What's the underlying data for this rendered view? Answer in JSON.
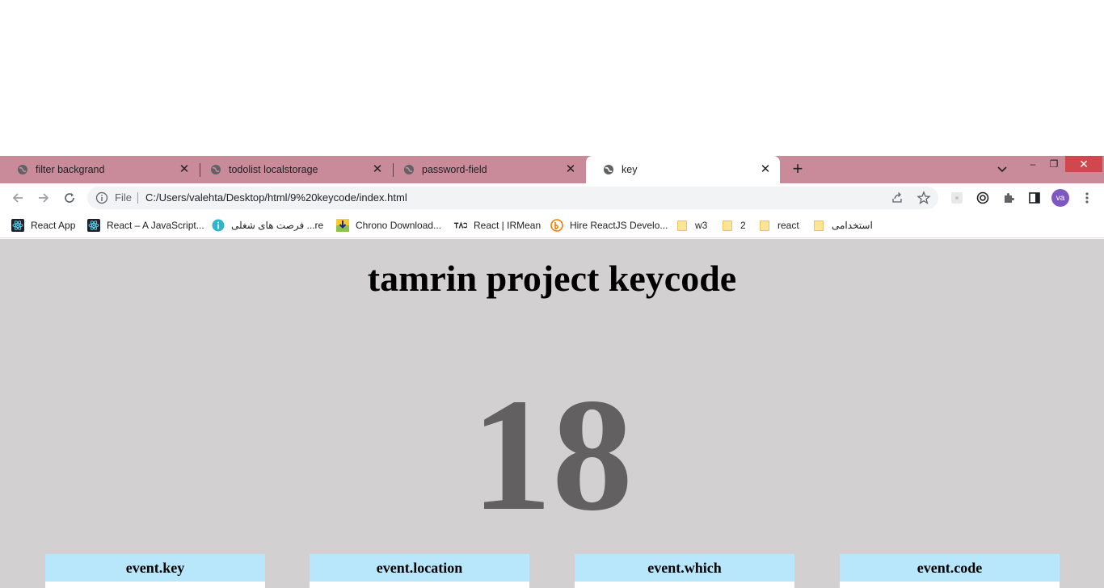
{
  "browser": {
    "tabs": [
      {
        "title": "filter backgrand",
        "active": false
      },
      {
        "title": "todolist localstorage",
        "active": false
      },
      {
        "title": "password-field",
        "active": false
      },
      {
        "title": "key",
        "active": true
      }
    ],
    "tab_close_glyph": "✕",
    "new_tab_glyph": "+",
    "window_controls": {
      "minimize": "–",
      "restore": "❐",
      "close": "✕"
    },
    "colors": {
      "tab_strip": "#c98a99",
      "active_tab": "#ffffff",
      "close_button": "#d0474d"
    }
  },
  "toolbar": {
    "scheme_label": "File",
    "url": "C:/Users/valehta/Desktop/html/9%20keycode/index.html",
    "avatar_initials": "va",
    "avatar_color": "#7e57c2"
  },
  "bookmarks": [
    {
      "label": "React App",
      "icon": "react-icon"
    },
    {
      "label": "React – A JavaScript...",
      "icon": "react-icon"
    },
    {
      "label": "فرصت های شغلی ...re",
      "icon": "jobinja-icon"
    },
    {
      "label": "Chrono Download...",
      "icon": "download-icon"
    },
    {
      "label": "React | IRMean",
      "icon": "irmean-icon"
    },
    {
      "label": "Hire ReactJS Develo...",
      "icon": "hire-icon"
    },
    {
      "label": "w3",
      "icon": "folder-icon"
    },
    {
      "label": "2",
      "icon": "folder-icon"
    },
    {
      "label": "react",
      "icon": "folder-icon"
    },
    {
      "label": "استخدامی",
      "icon": "folder-icon"
    }
  ],
  "page": {
    "title": "tamrin project keycode",
    "keycode": "18",
    "cards": [
      {
        "label": "event.key"
      },
      {
        "label": "event.location"
      },
      {
        "label": "event.which"
      },
      {
        "label": "event.code"
      }
    ],
    "colors": {
      "background": "#d2d0d1",
      "keycode_text": "#626061",
      "card_header": "#b8e6fb"
    }
  }
}
